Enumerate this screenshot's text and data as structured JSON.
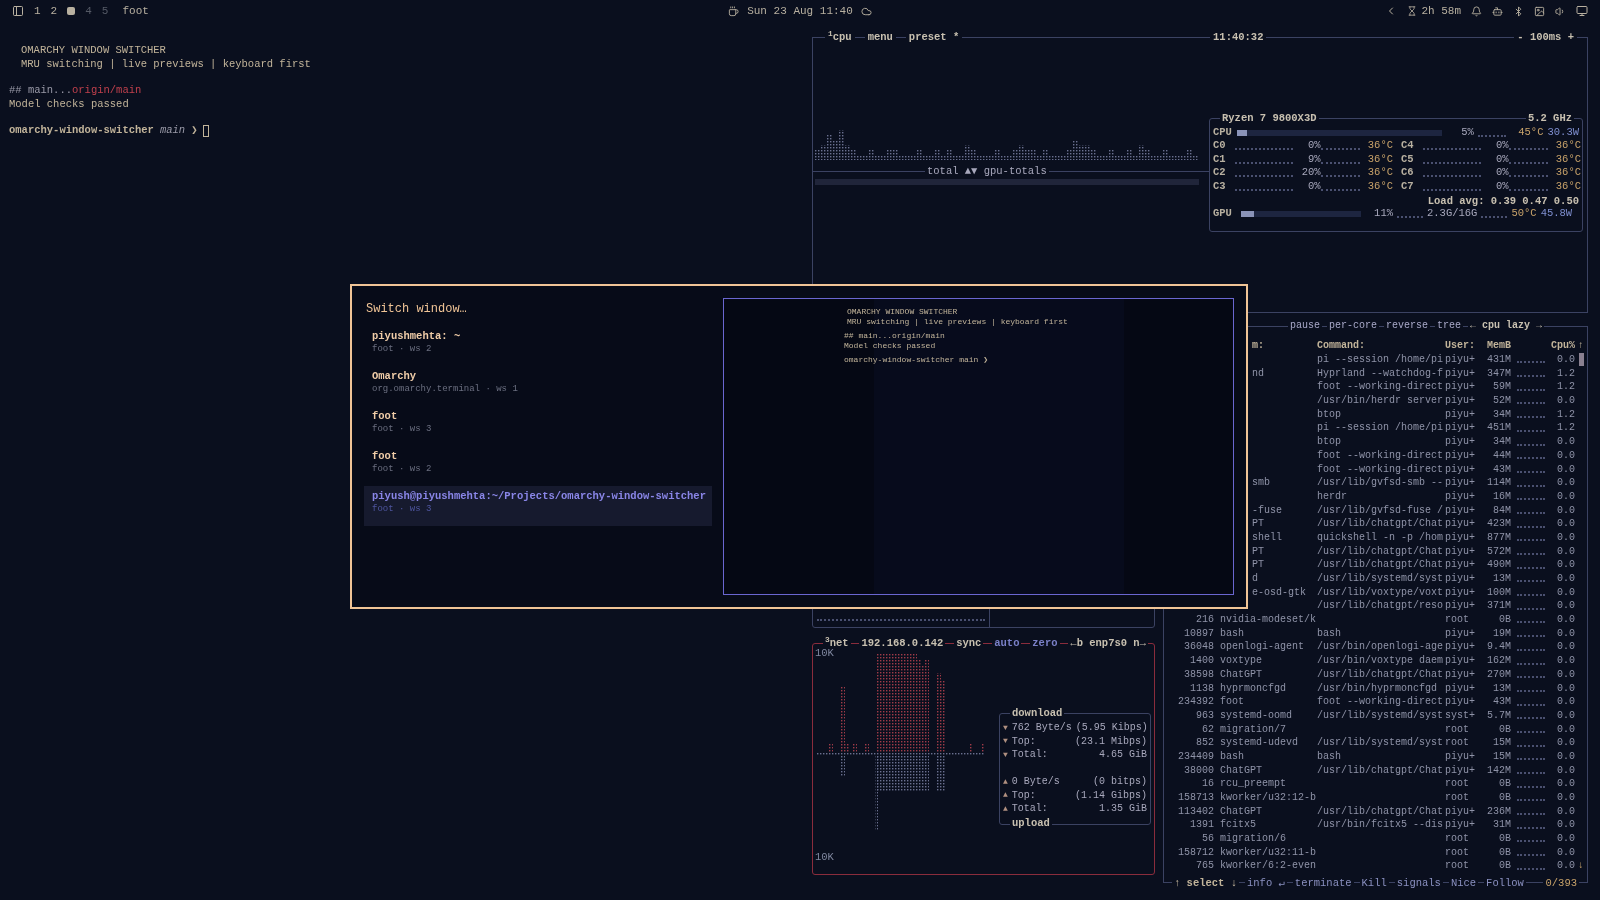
{
  "top_bar": {
    "workspaces": [
      {
        "label": "1",
        "selected": false,
        "occupied": true
      },
      {
        "label": "2",
        "selected": false,
        "occupied": true
      },
      {
        "selected": true,
        "occupied": true
      },
      {
        "label": "4",
        "selected": false,
        "occupied": false
      },
      {
        "label": "5",
        "selected": false,
        "occupied": false
      }
    ],
    "window_title": "foot",
    "clock": "Sun 23 Aug 11:40",
    "battery_time": "2h 58m"
  },
  "terminal": {
    "banner": [
      "OMARCHY WINDOW SWITCHER",
      "MRU switching | live previews | keyboard first"
    ],
    "git_status": {
      "branch": "## main...",
      "upstream": "origin/main"
    },
    "message": "Model checks passed",
    "prompt": {
      "directory": "omarchy-window-switcher",
      "branch": "main",
      "symbol": "❯"
    }
  },
  "cpu_panel": {
    "header_left": [
      "$^{1}$cpu",
      "menu",
      "preset *"
    ],
    "clock": "11:40:32",
    "interval": "- 100ms +",
    "graph_label": "total ▲▼ gpu-totals",
    "cpu_info": {
      "model": "Ryzen 7 9800X3D",
      "frequency": "5.2 GHz",
      "cpu": {
        "label": "CPU",
        "level": 0.05,
        "percent": "5%",
        "temp": "45°C",
        "power": "30.3W"
      },
      "cores": [
        {
          "label": "C0",
          "percent": "0%",
          "temp": "36°C"
        },
        {
          "label": "C1",
          "percent": "9%",
          "temp": "36°C"
        },
        {
          "label": "C2",
          "percent": "20%",
          "temp": "36°C"
        },
        {
          "label": "C3",
          "percent": "0%",
          "temp": "36°C"
        },
        {
          "label": "C4",
          "percent": "0%",
          "temp": "36°C"
        },
        {
          "label": "C5",
          "percent": "0%",
          "temp": "36°C"
        },
        {
          "label": "C6",
          "percent": "0%",
          "temp": "36°C"
        },
        {
          "label": "C7",
          "percent": "0%",
          "temp": "36°C"
        }
      ],
      "load_avg": "Load avg: 0.39 0.47 0.50",
      "gpu": {
        "label": "GPU",
        "level": 0.11,
        "percent": "11%",
        "memory": "2.3G/16G",
        "temp": "50°C",
        "power": "45.8W"
      }
    }
  },
  "process_panel": {
    "header": [
      "pause",
      "per-core",
      "reverse",
      "tree",
      "← cpu lazy →"
    ],
    "columns": [
      "m:",
      "Command:",
      "User:",
      "MemB",
      "Cpu%"
    ],
    "scroll_up": "↑",
    "scroll_down": "↓",
    "rows": [
      {
        "command": "pi --session /home/pi",
        "user": "piyu+",
        "mem": "431M",
        "cpu": "0.0"
      },
      {
        "program": "nd",
        "command": "Hyprland --watchdog-f",
        "user": "piyu+",
        "mem": "347M",
        "cpu": "1.2"
      },
      {
        "command": "foot --working-direct",
        "user": "piyu+",
        "mem": "59M",
        "cpu": "1.2"
      },
      {
        "command": "/usr/bin/herdr server",
        "user": "piyu+",
        "mem": "52M",
        "cpu": "0.0"
      },
      {
        "command": "btop",
        "user": "piyu+",
        "mem": "34M",
        "cpu": "1.2"
      },
      {
        "command": "pi --session /home/pi",
        "user": "piyu+",
        "mem": "451M",
        "cpu": "1.2"
      },
      {
        "command": "btop",
        "user": "piyu+",
        "mem": "34M",
        "cpu": "0.0"
      },
      {
        "command": "foot --working-direct",
        "user": "piyu+",
        "mem": "44M",
        "cpu": "0.0"
      },
      {
        "command": "foot --working-direct",
        "user": "piyu+",
        "mem": "43M",
        "cpu": "0.0"
      },
      {
        "program": "smb",
        "command": "/usr/lib/gvfsd-smb --",
        "user": "piyu+",
        "mem": "114M",
        "cpu": "0.0"
      },
      {
        "command": "herdr",
        "user": "piyu+",
        "mem": "16M",
        "cpu": "0.0"
      },
      {
        "program": "-fuse",
        "command": "/usr/lib/gvfsd-fuse /",
        "user": "piyu+",
        "mem": "84M",
        "cpu": "0.0"
      },
      {
        "program": "PT",
        "command": "/usr/lib/chatgpt/Chat",
        "user": "piyu+",
        "mem": "423M",
        "cpu": "0.0"
      },
      {
        "program": "shell",
        "command": "quickshell -n -p /hom",
        "user": "piyu+",
        "mem": "877M",
        "cpu": "0.0"
      },
      {
        "program": "PT",
        "command": "/usr/lib/chatgpt/Chat",
        "user": "piyu+",
        "mem": "572M",
        "cpu": "0.0"
      },
      {
        "program": "PT",
        "command": "/usr/lib/chatgpt/Chat",
        "user": "piyu+",
        "mem": "490M",
        "cpu": "0.0"
      },
      {
        "program": "d",
        "command": "/usr/lib/systemd/syst",
        "user": "piyu+",
        "mem": "13M",
        "cpu": "0.0"
      },
      {
        "program": "e-osd-gtk",
        "command": "/usr/lib/voxtype/voxt",
        "user": "piyu+",
        "mem": "100M",
        "cpu": "0.0"
      },
      {
        "command": "/usr/lib/chatgpt/reso",
        "user": "piyu+",
        "mem": "371M",
        "cpu": "0.0"
      },
      {
        "pid": "216",
        "program": "nvidia-modeset/k",
        "user": "root",
        "mem": "0B",
        "cpu": "0.0"
      },
      {
        "pid": "10897",
        "program": "bash",
        "command": "bash",
        "user": "piyu+",
        "mem": "19M",
        "cpu": "0.0"
      },
      {
        "pid": "36048",
        "program": "openlogi-agent",
        "command": "/usr/bin/openlogi-age",
        "user": "piyu+",
        "mem": "9.4M",
        "cpu": "0.0"
      },
      {
        "pid": "1400",
        "program": "voxtype",
        "command": "/usr/bin/voxtype daem",
        "user": "piyu+",
        "mem": "162M",
        "cpu": "0.0"
      },
      {
        "pid": "38598",
        "program": "ChatGPT",
        "command": "/usr/lib/chatgpt/Chat",
        "user": "piyu+",
        "mem": "270M",
        "cpu": "0.0"
      },
      {
        "pid": "1138",
        "program": "hyprmoncfgd",
        "command": "/usr/bin/hyprmoncfgd",
        "user": "piyu+",
        "mem": "13M",
        "cpu": "0.0"
      },
      {
        "pid": "234392",
        "program": "foot",
        "command": "foot --working-direct",
        "user": "piyu+",
        "mem": "43M",
        "cpu": "0.0"
      },
      {
        "pid": "963",
        "program": "systemd-oomd",
        "command": "/usr/lib/systemd/syst",
        "user": "syst+",
        "mem": "5.7M",
        "cpu": "0.0"
      },
      {
        "pid": "62",
        "program": "migration/7",
        "user": "root",
        "mem": "0B",
        "cpu": "0.0"
      },
      {
        "pid": "852",
        "program": "systemd-udevd",
        "command": "/usr/lib/systemd/syst",
        "user": "root",
        "mem": "15M",
        "cpu": "0.0"
      },
      {
        "pid": "234409",
        "program": "bash",
        "command": "bash",
        "user": "piyu+",
        "mem": "15M",
        "cpu": "0.0"
      },
      {
        "pid": "38000",
        "program": "ChatGPT",
        "command": "/usr/lib/chatgpt/Chat",
        "user": "piyu+",
        "mem": "142M",
        "cpu": "0.0"
      },
      {
        "pid": "16",
        "program": "rcu_preempt",
        "user": "root",
        "mem": "0B",
        "cpu": "0.0"
      },
      {
        "pid": "158713",
        "program": "kworker/u32:12-b",
        "user": "root",
        "mem": "0B",
        "cpu": "0.0"
      },
      {
        "pid": "113402",
        "program": "ChatGPT",
        "command": "/usr/lib/chatgpt/Chat",
        "user": "piyu+",
        "mem": "236M",
        "cpu": "0.0"
      },
      {
        "pid": "1391",
        "program": "fcitx5",
        "command": "/usr/bin/fcitx5 --dis",
        "user": "piyu+",
        "mem": "31M",
        "cpu": "0.0"
      },
      {
        "pid": "56",
        "program": "migration/6",
        "user": "root",
        "mem": "0B",
        "cpu": "0.0"
      },
      {
        "pid": "158712",
        "program": "kworker/u32:11-b",
        "user": "root",
        "mem": "0B",
        "cpu": "0.0"
      },
      {
        "pid": "765",
        "program": "kworker/6:2-even",
        "user": "root",
        "mem": "0B",
        "cpu": "0.0"
      }
    ],
    "footer": [
      "↑ select ↓",
      "info ↵",
      "terminate",
      "Kill",
      "signals",
      "Nice",
      "Follow"
    ],
    "count": "0/393"
  },
  "net_panel": {
    "header": [
      "$^{3}$net",
      "192.168.0.142",
      "sync",
      "auto",
      "zero",
      "←b enp7s0 n→"
    ],
    "scale_top": "10K",
    "scale_bottom": "10K",
    "download": {
      "title": "download",
      "rows": [
        {
          "arrow": "▼",
          "label": "762 Byte/s",
          "value": "(5.95 Kibps)"
        },
        {
          "arrow": "▼",
          "label": "Top:",
          "value": "(23.1 Mibps)"
        },
        {
          "arrow": "▼",
          "label": "Total:",
          "value": "4.65 GiB"
        }
      ]
    },
    "upload": {
      "title": "upload",
      "rows": [
        {
          "arrow": "▲",
          "label": "0 Byte/s",
          "value": "(0 bitps)"
        },
        {
          "arrow": "▲",
          "label": "Top:",
          "value": "(1.14 Gibps)"
        },
        {
          "arrow": "▲",
          "label": "Total:",
          "value": "1.35 GiB"
        }
      ]
    }
  },
  "switcher": {
    "title": "Switch window…",
    "windows": [
      {
        "title": "piyushmehta: ~",
        "subtitle": "foot · ws 2",
        "selected": false
      },
      {
        "title": "Omarchy",
        "subtitle": "org.omarchy.terminal · ws 1",
        "selected": false
      },
      {
        "title": "foot",
        "subtitle": "foot · ws 3",
        "selected": false
      },
      {
        "title": "foot",
        "subtitle": "foot · ws 2",
        "selected": false
      },
      {
        "title": "piyush@piyushmehta:~/Projects/omarchy-window-switcher",
        "subtitle": "foot · ws 3",
        "selected": true
      }
    ],
    "preview_lines": [
      "OMARCHY WINDOW SWITCHER",
      "MRU switching | live previews | keyboard first",
      "## main...origin/main",
      "Model checks passed",
      "omarchy-window-switcher main ❯"
    ]
  }
}
